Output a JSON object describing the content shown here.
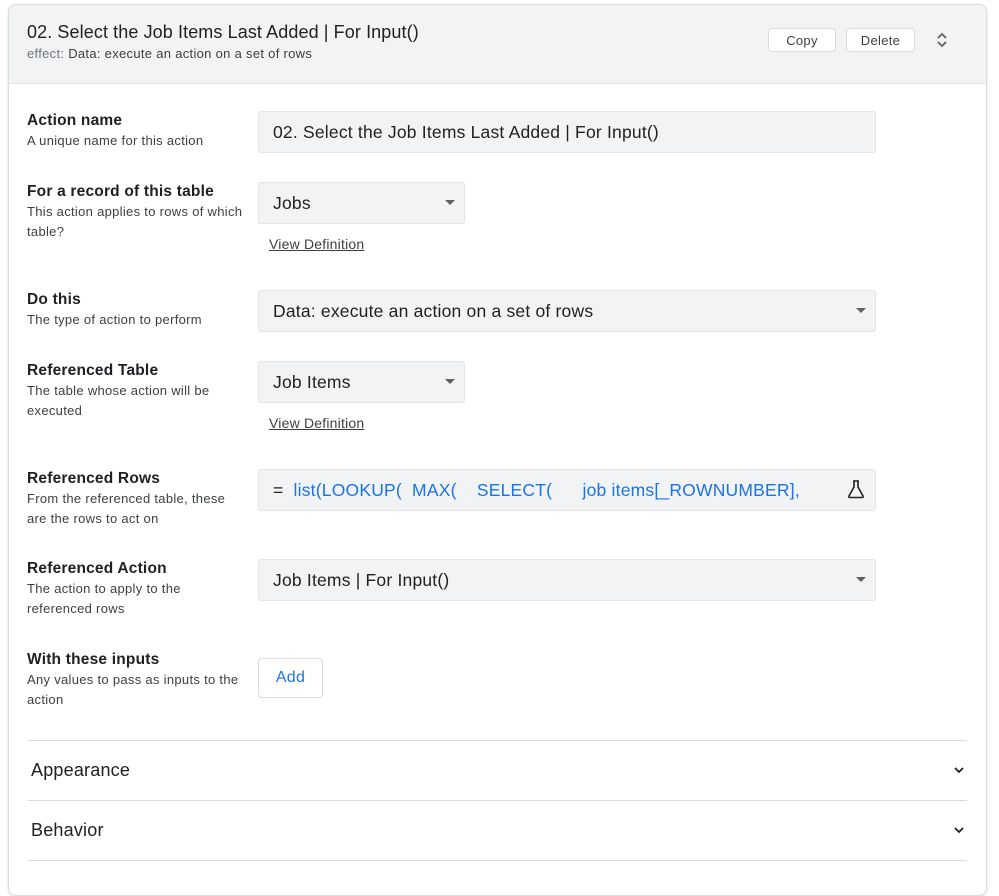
{
  "header": {
    "title": "02. Select the Job Items Last Added | For Input()",
    "effect_label": "effect:",
    "effect_value": "Data: execute an action on a set of rows",
    "copy_label": "Copy",
    "delete_label": "Delete",
    "expand_icon": "unfold-icon"
  },
  "action_name": {
    "label": "Action name",
    "description": "A unique name for this action",
    "value": "02. Select the Job Items Last Added | For Input()"
  },
  "for_record": {
    "label": "For a record of this table",
    "description": "This action applies to rows of which table?",
    "value": "Jobs",
    "link": "View Definition"
  },
  "do_this": {
    "label": "Do this",
    "description": "The type of action to perform",
    "value": "Data: execute an action on a set of rows"
  },
  "referenced_table": {
    "label": "Referenced Table",
    "description": "The table whose action will be executed",
    "value": "Job Items",
    "link": "View Definition"
  },
  "referenced_rows": {
    "label": "Referenced Rows",
    "description": "From the referenced table, these are the rows to act on",
    "eq": "=",
    "expression": "list(LOOKUP(  MAX(    SELECT(      job items[_ROWNUMBER],       ([_thisr",
    "icon": "flask-icon"
  },
  "referenced_action": {
    "label": "Referenced Action",
    "description": "The action to apply to the referenced rows",
    "value": "Job Items | For Input()"
  },
  "with_inputs": {
    "label": "With these inputs",
    "description": "Any values to pass as inputs to the action",
    "add_label": "Add"
  },
  "sections": [
    {
      "title": "Appearance"
    },
    {
      "title": "Behavior"
    }
  ],
  "colors": {
    "accent": "#1a73e8",
    "header_bg": "#f1f3f4",
    "field_bg": "#f1f3f4"
  }
}
